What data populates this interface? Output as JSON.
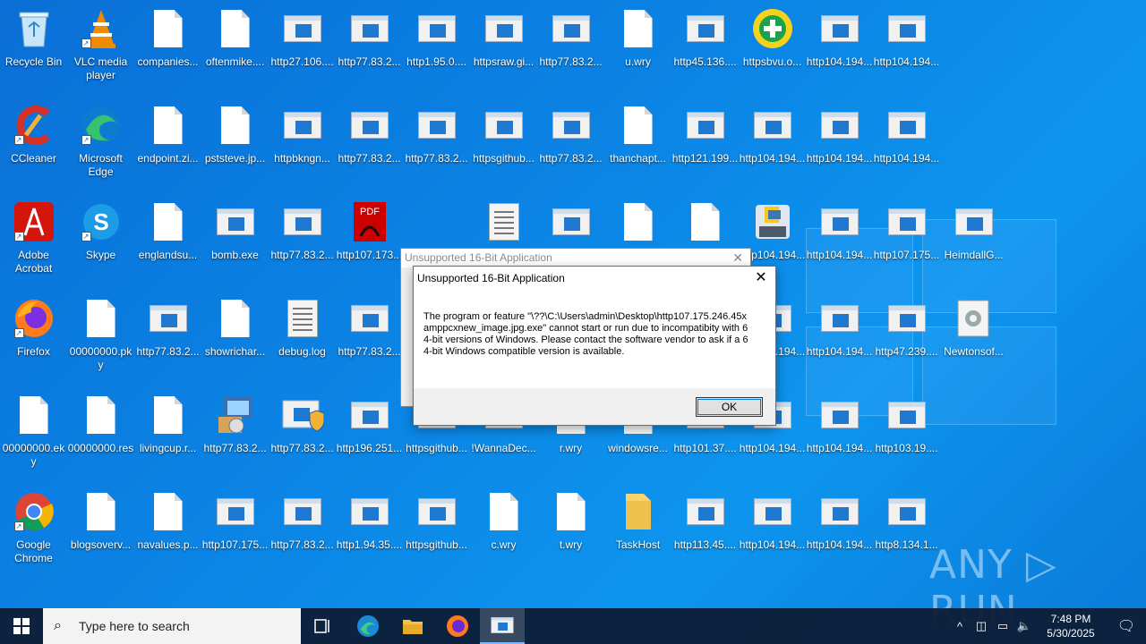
{
  "desktop": {
    "icons": [
      {
        "label": "Recycle Bin",
        "type": "recycle"
      },
      {
        "label": "VLC media player",
        "type": "vlc"
      },
      {
        "label": "companies...",
        "type": "doc"
      },
      {
        "label": "oftenmike....",
        "type": "doc"
      },
      {
        "label": "http27.106....",
        "type": "exe"
      },
      {
        "label": "http77.83.2...",
        "type": "exe"
      },
      {
        "label": "http1.95.0....",
        "type": "exe"
      },
      {
        "label": "httpsraw.gi...",
        "type": "exe"
      },
      {
        "label": "http77.83.2...",
        "type": "exe"
      },
      {
        "label": "u.wry",
        "type": "doc"
      },
      {
        "label": "http45.136....",
        "type": "exe"
      },
      {
        "label": "httpsbvu.o...",
        "type": "green"
      },
      {
        "label": "http104.194...",
        "type": "exe"
      },
      {
        "label": "http104.194...",
        "type": "exe"
      },
      {
        "label": "CCleaner",
        "type": "ccleaner"
      },
      {
        "label": "Microsoft Edge",
        "type": "edge"
      },
      {
        "label": "endpoint.zi...",
        "type": "doc"
      },
      {
        "label": "pststeve.jp...",
        "type": "doc"
      },
      {
        "label": "httpbkngn...",
        "type": "exe"
      },
      {
        "label": "http77.83.2...",
        "type": "exe"
      },
      {
        "label": "http77.83.2...",
        "type": "exe"
      },
      {
        "label": "httpsgithub...",
        "type": "exe"
      },
      {
        "label": "http77.83.2...",
        "type": "exe"
      },
      {
        "label": "thanchapt...",
        "type": "doc"
      },
      {
        "label": "http121.199...",
        "type": "exe"
      },
      {
        "label": "http104.194...",
        "type": "exe"
      },
      {
        "label": "http104.194...",
        "type": "exe"
      },
      {
        "label": "http104.194...",
        "type": "exe"
      },
      {
        "label": "Adobe Acrobat",
        "type": "acrobat"
      },
      {
        "label": "Skype",
        "type": "skype"
      },
      {
        "label": "englandsu...",
        "type": "doc"
      },
      {
        "label": "bomb.exe",
        "type": "exe"
      },
      {
        "label": "http77.83.2...",
        "type": "exe"
      },
      {
        "label": "http107.173...",
        "type": "pdf"
      },
      {
        "label": "",
        "type": "lines"
      },
      {
        "label": "",
        "type": "exe"
      },
      {
        "label": "",
        "type": "doc"
      },
      {
        "label": "",
        "type": "doc"
      },
      {
        "label": "http104.194...",
        "type": "python"
      },
      {
        "label": "http104.194...",
        "type": "exe"
      },
      {
        "label": "http107.175...",
        "type": "exe"
      },
      {
        "label": "HeimdallG...",
        "type": "exe"
      },
      {
        "label": "Firefox",
        "type": "firefox"
      },
      {
        "label": "00000000.pky",
        "type": "doc"
      },
      {
        "label": "http77.83.2...",
        "type": "exe"
      },
      {
        "label": "showrichar...",
        "type": "doc"
      },
      {
        "label": "debug.log",
        "type": "lines"
      },
      {
        "label": "http77.83.2...",
        "type": "exe"
      },
      {
        "label": "http104.194...",
        "type": "exe"
      },
      {
        "label": "http104.194...",
        "type": "exe"
      },
      {
        "label": "http47.239....",
        "type": "exe"
      },
      {
        "label": "Newtonsof...",
        "type": "gear"
      },
      {
        "label": "00000000.eky",
        "type": "doc"
      },
      {
        "label": "00000000.res",
        "type": "doc"
      },
      {
        "label": "livingcup.r...",
        "type": "doc"
      },
      {
        "label": "http77.83.2...",
        "type": "installer"
      },
      {
        "label": "http77.83.2...",
        "type": "shield"
      },
      {
        "label": "http196.251...",
        "type": "exe"
      },
      {
        "label": "httpsgithub...",
        "type": "exe"
      },
      {
        "label": "!WannaDec...",
        "type": "exe"
      },
      {
        "label": "r.wry",
        "type": "doc"
      },
      {
        "label": "windowsre...",
        "type": "doc"
      },
      {
        "label": "http101.37....",
        "type": "exe"
      },
      {
        "label": "http104.194...",
        "type": "exe"
      },
      {
        "label": "http104.194...",
        "type": "exe"
      },
      {
        "label": "http103.19....",
        "type": "exe"
      },
      {
        "label": "Google Chrome",
        "type": "chrome"
      },
      {
        "label": "blogsoverv...",
        "type": "doc"
      },
      {
        "label": "navalues.p...",
        "type": "doc"
      },
      {
        "label": "http107.175...",
        "type": "exe"
      },
      {
        "label": "http77.83.2...",
        "type": "exe"
      },
      {
        "label": "http1.94.35....",
        "type": "exe"
      },
      {
        "label": "httpsgithub...",
        "type": "exe"
      },
      {
        "label": "c.wry",
        "type": "doc"
      },
      {
        "label": "t.wry",
        "type": "doc"
      },
      {
        "label": "TaskHost",
        "type": "folder"
      },
      {
        "label": "http113.45....",
        "type": "exe"
      },
      {
        "label": "http104.194...",
        "type": "exe"
      },
      {
        "label": "http104.194...",
        "type": "exe"
      },
      {
        "label": "http8.134.1...",
        "type": "exe"
      }
    ]
  },
  "dialog_back": {
    "title": "Unsupported 16-Bit Application",
    "close": "✕"
  },
  "dialog": {
    "title": "Unsupported 16-Bit Application",
    "close": "✕",
    "message": "The program or feature \"\\??\\C:\\Users\\admin\\Desktop\\http107.175.246.45xamppcxnew_image.jpg.exe\" cannot start or run due to incompatibity with 64-bit versions of Windows. Please contact the software vendor to ask if a 64-bit Windows compatible version is available.",
    "ok_label": "OK"
  },
  "watermark": "ANY ▷ RUN",
  "taskbar": {
    "search_placeholder": "Type here to search",
    "time": "7:48 PM",
    "date": "5/30/2025"
  },
  "colors": {
    "desktop_bg": "#0b86e6",
    "taskbar_bg": "#0c1e37",
    "accent": "#0078d7"
  }
}
